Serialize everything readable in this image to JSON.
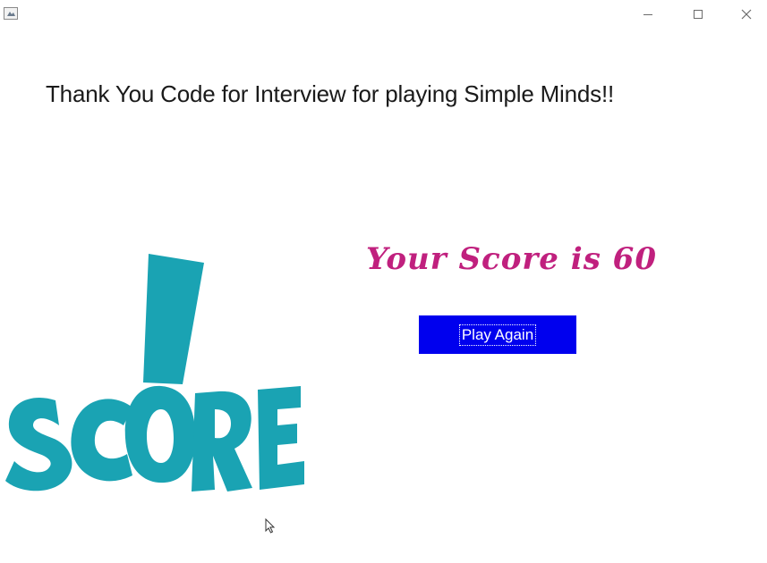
{
  "window": {
    "icon": "java-app-icon",
    "controls": {
      "minimize_icon": "minimize-icon",
      "maximize_icon": "maximize-icon",
      "close_icon": "close-icon"
    }
  },
  "main": {
    "heading": "Thank You Code for Interview for playing Simple Minds!!",
    "score_text": "Your Score is 60",
    "play_again_label": "Play Again"
  },
  "logo": {
    "text": "SCORE",
    "color": "#1aa3b3"
  },
  "colors": {
    "score_text": "#c0207e",
    "button_bg": "#0000ee",
    "button_text": "#ffffff"
  }
}
